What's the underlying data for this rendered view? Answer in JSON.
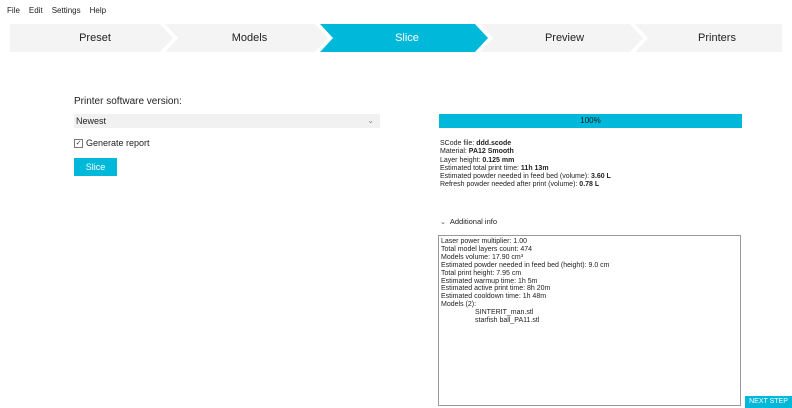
{
  "menu": {
    "file": "File",
    "edit": "Edit",
    "settings": "Settings",
    "help": "Help"
  },
  "wizard": {
    "steps": [
      {
        "label": "Preset",
        "active": false
      },
      {
        "label": "Models",
        "active": false
      },
      {
        "label": "Slice",
        "active": true
      },
      {
        "label": "Preview",
        "active": false
      },
      {
        "label": "Printers",
        "active": false
      }
    ],
    "colors": {
      "active": "#00b8d9",
      "inactive": "#f4f4f4",
      "separator": "#ffffff"
    }
  },
  "slice_form": {
    "version_label": "Printer software version:",
    "version_selected": "Newest",
    "generate_report_label": "Generate report",
    "generate_report_checked": true,
    "slice_button": "Slice"
  },
  "progress": {
    "text": "100%",
    "fraction": 1.0
  },
  "summary": {
    "gcode_file_label": "SCode file: ",
    "gcode_file_value": "ddd.scode",
    "material_label": "Material: ",
    "material_value": "PA12 Smooth",
    "layer_height_label": "Layer height: ",
    "layer_height_value": "0.125 mm",
    "print_time_label": "Estimated total print time: ",
    "print_time_value": "11h 13m",
    "powder_feed_label": "Estimated powder needed in feed bed (volume): ",
    "powder_feed_value": "3.60 L",
    "refresh_powder_label": "Refresh powder needed after print (volume): ",
    "refresh_powder_value": "0.78 L"
  },
  "additional_info": {
    "toggle_label": "Additional info",
    "lines": [
      "Laser power multiplier: 1.00",
      "Total model layers count: 474",
      "Models volume: 17.90 cm³",
      "Estimated powder needed in feed bed (height): 9.0 cm",
      "Total print height: 7.95 cm",
      "Estimated warmup time: 1h 5m",
      "Estimated active print time: 8h 20m",
      "Estimated cooldown time: 1h 48m",
      "Models (2):"
    ],
    "models": [
      "SINTERIT_man.stl",
      "starfish ball_PA11.stl"
    ]
  },
  "next_step_button": "NEXT STEP",
  "accent_color": "#00b8d9"
}
